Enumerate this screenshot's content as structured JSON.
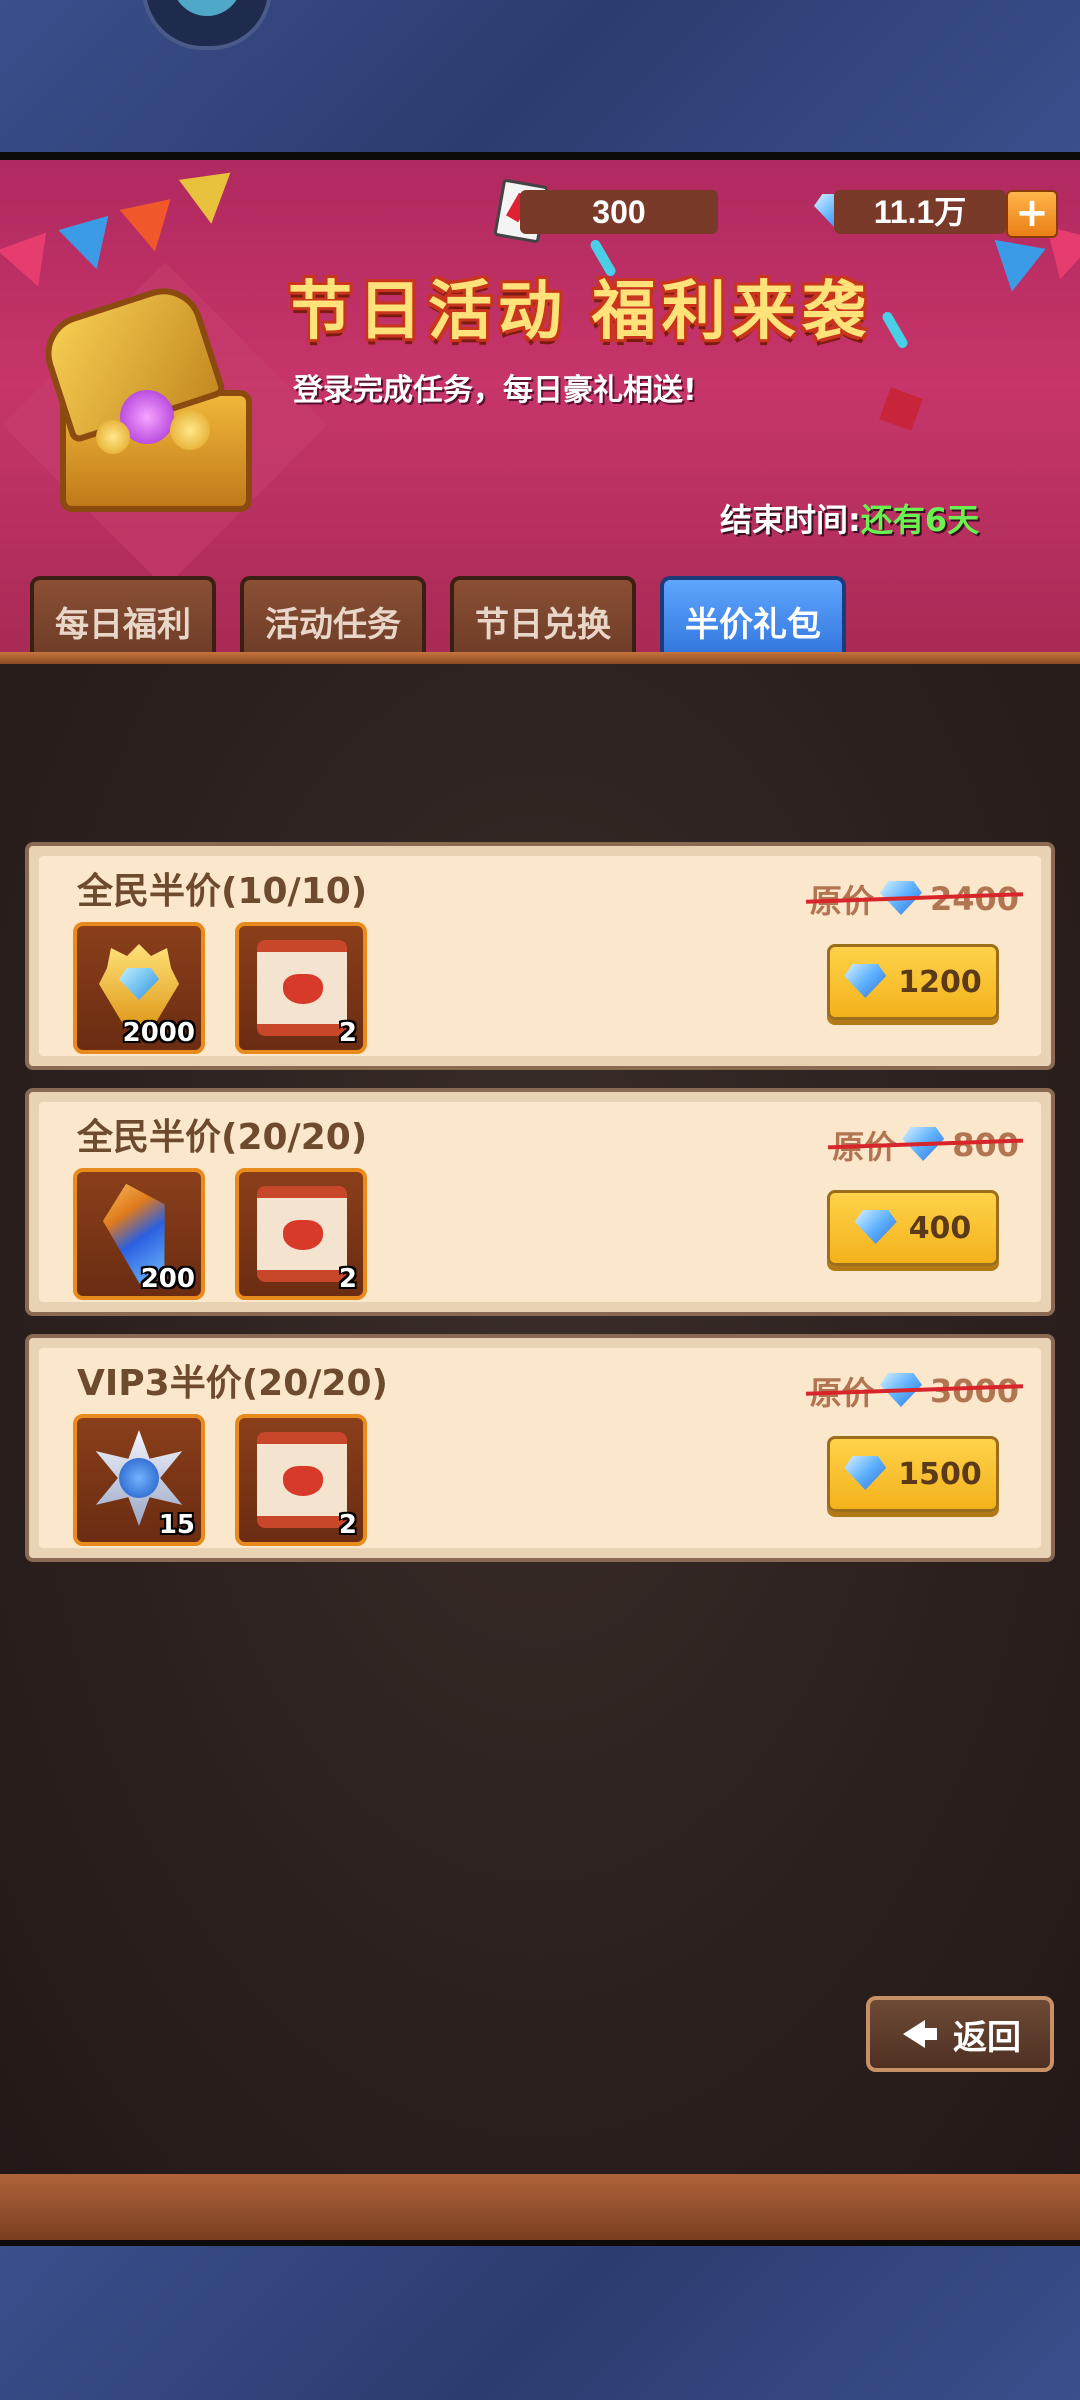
{
  "header": {
    "ticket_count": "300",
    "gem_count": "11.1万",
    "title": "节日活动 福利来袭",
    "subtitle": "登录完成任务，每日豪礼相送!",
    "end_time_label": "结束时间:",
    "end_time_value": "还有6天"
  },
  "tabs": [
    {
      "label": "每日福利",
      "active": false
    },
    {
      "label": "活动任务",
      "active": false
    },
    {
      "label": "节日兑换",
      "active": false
    },
    {
      "label": "半价礼包",
      "active": true
    }
  ],
  "packs": [
    {
      "title": "全民半价(10/10)",
      "original_label": "原价",
      "original_price": "2400",
      "price": "1200",
      "items": [
        {
          "icon": "crown-gem-badge-icon",
          "count": "2000"
        },
        {
          "icon": "scroll-icon",
          "count": "2"
        }
      ]
    },
    {
      "title": "全民半价(20/20)",
      "original_label": "原价",
      "original_price": "800",
      "price": "400",
      "items": [
        {
          "icon": "blue-crystal-icon",
          "count": "200"
        },
        {
          "icon": "scroll-icon",
          "count": "2"
        }
      ]
    },
    {
      "title": "VIP3半价(20/20)",
      "original_label": "原价",
      "original_price": "3000",
      "price": "1500",
      "items": [
        {
          "icon": "star-emblem-icon",
          "count": "15"
        },
        {
          "icon": "scroll-icon",
          "count": "2"
        }
      ]
    }
  ],
  "footer": {
    "back_label": "返回"
  },
  "colors": {
    "tab_active": "#2c6fd8",
    "price_button": "#f3b21b",
    "time_green": "#6bf052",
    "strike_red": "#d8242b"
  }
}
